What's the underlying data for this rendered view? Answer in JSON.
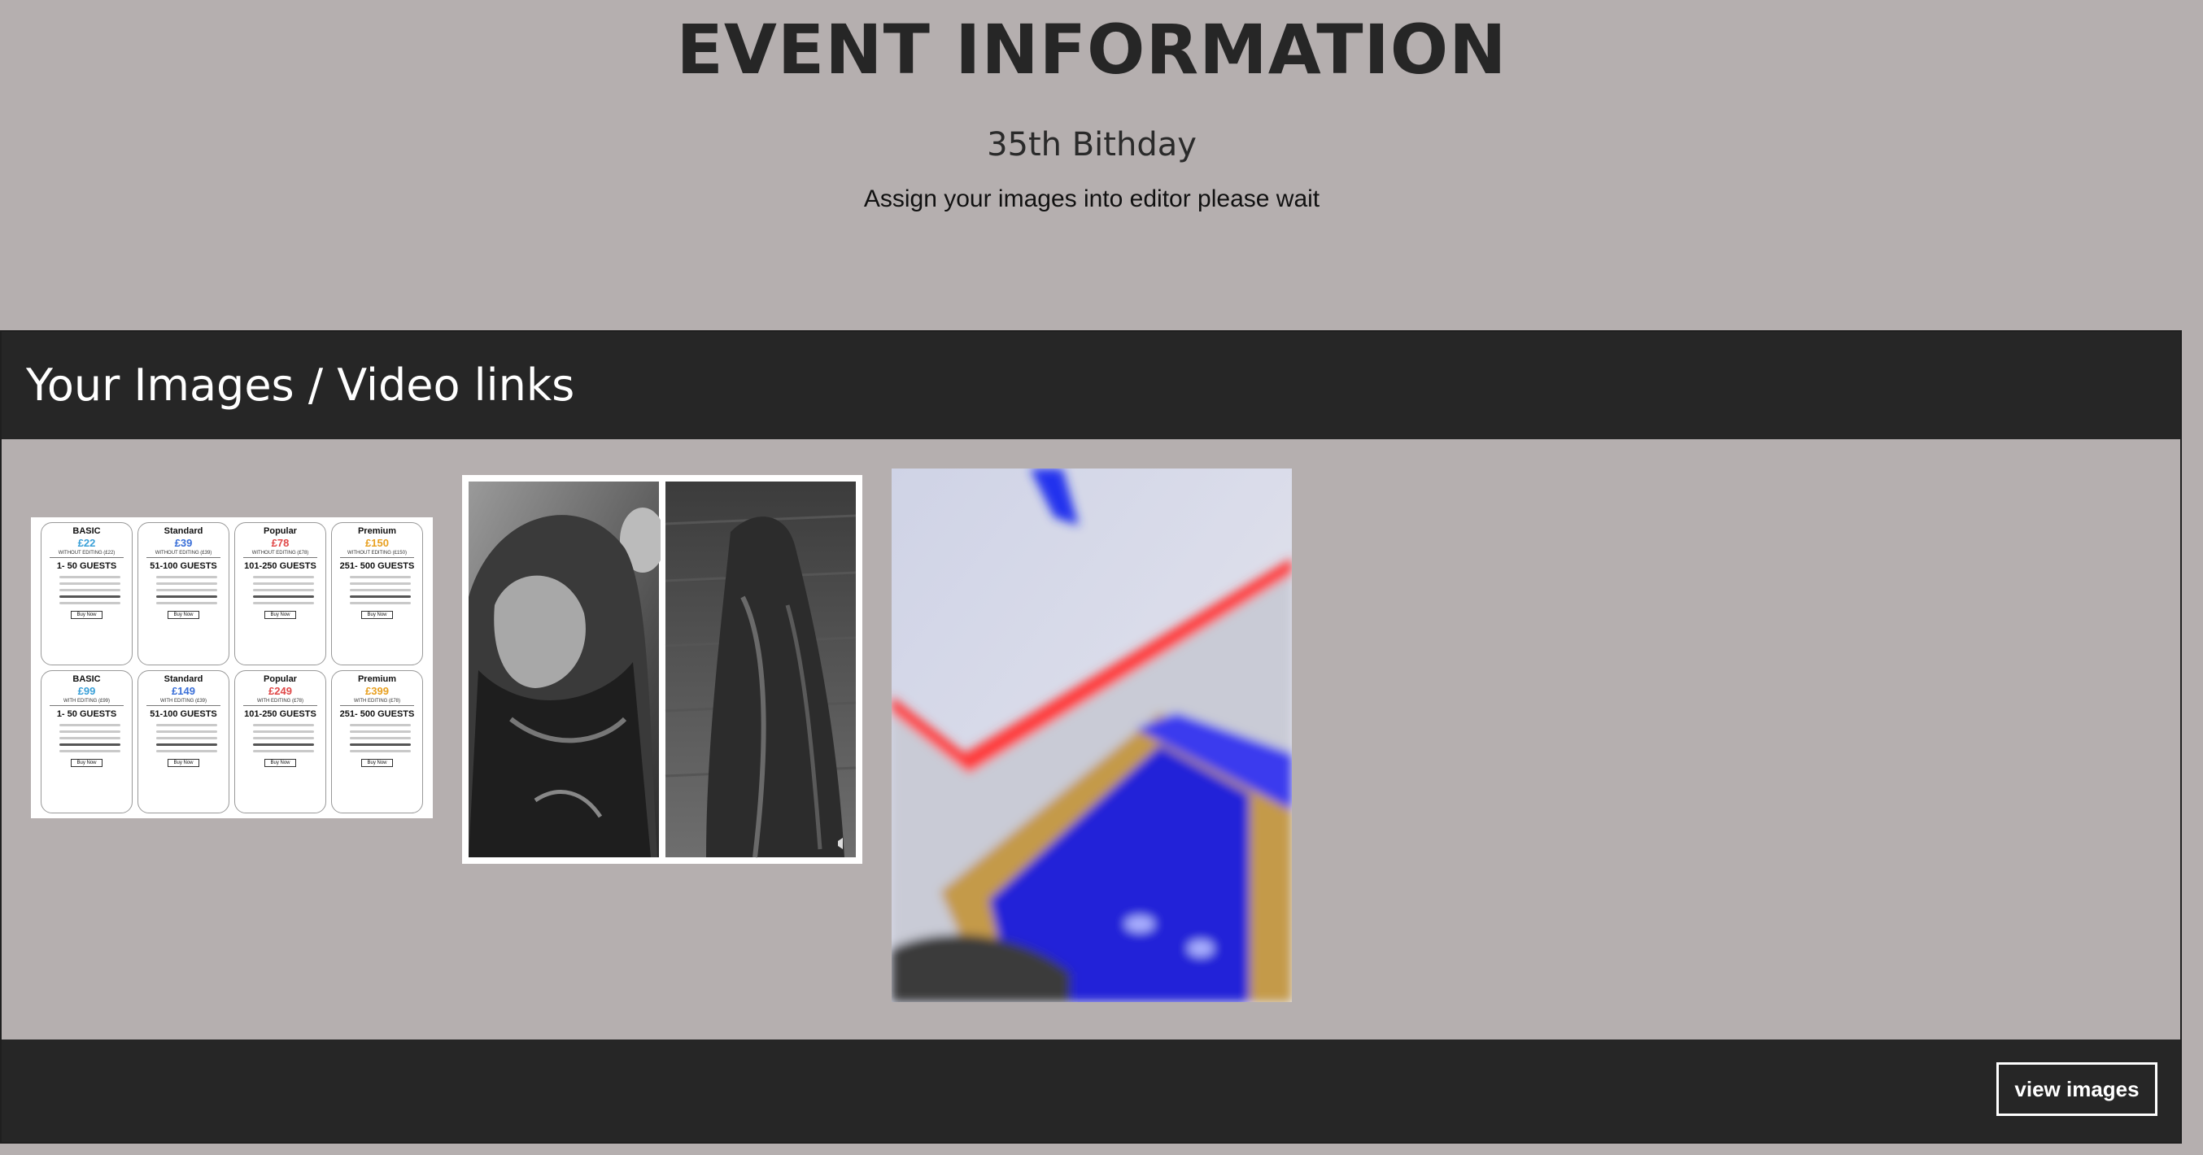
{
  "header": {
    "title": "EVENT INFORMATION",
    "event_name": "35th Bithday",
    "status": "Assign your images into editor please wait"
  },
  "gallery": {
    "title": "Your Images / Video links",
    "pricing_cards": [
      {
        "tier": "BASIC",
        "price": "£22",
        "price_color": "#3aa0d8",
        "sub": "WITHOUT EDITING (£22)",
        "guests": "1- 50 GUESTS",
        "button": "Buy Now"
      },
      {
        "tier": "Standard",
        "price": "£39",
        "price_color": "#3a6fd8",
        "sub": "WITHOUT EDITING (£39)",
        "guests": "51-100 GUESTS",
        "button": "Buy Now"
      },
      {
        "tier": "Popular",
        "price": "£78",
        "price_color": "#e04848",
        "sub": "WITHOUT EDITING (£78)",
        "guests": "101-250 GUESTS",
        "button": "Buy Now"
      },
      {
        "tier": "Premium",
        "price": "£150",
        "price_color": "#e8a020",
        "sub": "WITHOUT EDITING (£150)",
        "guests": "251- 500 GUESTS",
        "button": "Buy Now"
      },
      {
        "tier": "BASIC",
        "price": "£99",
        "price_color": "#3aa0d8",
        "sub": "WITH EDITING (£99)",
        "guests": "1- 50 GUESTS",
        "button": "Buy Now"
      },
      {
        "tier": "Standard",
        "price": "£149",
        "price_color": "#3a6fd8",
        "sub": "WITH EDITING (£39)",
        "guests": "51-100 GUESTS",
        "button": "Buy Now"
      },
      {
        "tier": "Popular",
        "price": "£249",
        "price_color": "#e04848",
        "sub": "WITH EDITING (£78)",
        "guests": "101-250 GUESTS",
        "button": "Buy Now"
      },
      {
        "tier": "Premium",
        "price": "£399",
        "price_color": "#e8a020",
        "sub": "WITH EDITING (£78)",
        "guests": "251- 500 GUESTS",
        "button": "Buy Now"
      }
    ]
  },
  "footer": {
    "view_button": "view images"
  },
  "colors": {
    "page_bg": "#b5afaf",
    "bar_bg": "#262626",
    "title_text": "#262626"
  }
}
